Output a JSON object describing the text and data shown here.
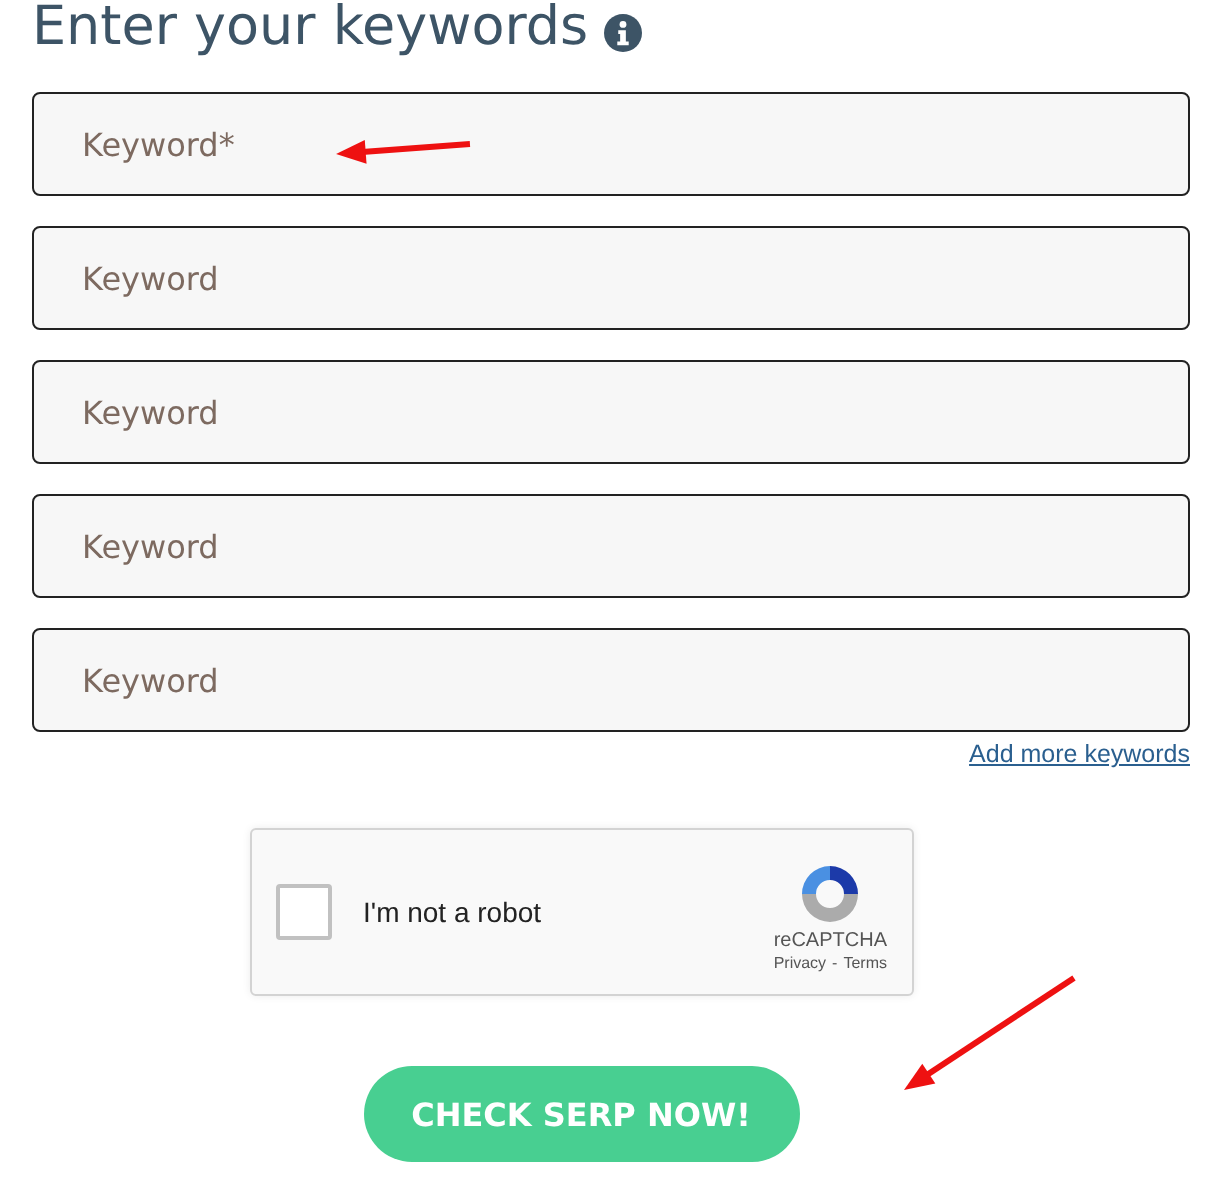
{
  "heading": {
    "title": "Enter your keywords"
  },
  "keywords": [
    {
      "placeholder": "Keyword*"
    },
    {
      "placeholder": "Keyword"
    },
    {
      "placeholder": "Keyword"
    },
    {
      "placeholder": "Keyword"
    },
    {
      "placeholder": "Keyword"
    }
  ],
  "add_more_link": "Add more keywords",
  "captcha": {
    "label": "I'm not a robot",
    "checked": false,
    "brand": "reCAPTCHA",
    "privacy": "Privacy",
    "separator": "-",
    "terms": "Terms"
  },
  "submit_button": "CHECK SERP NOW!"
}
